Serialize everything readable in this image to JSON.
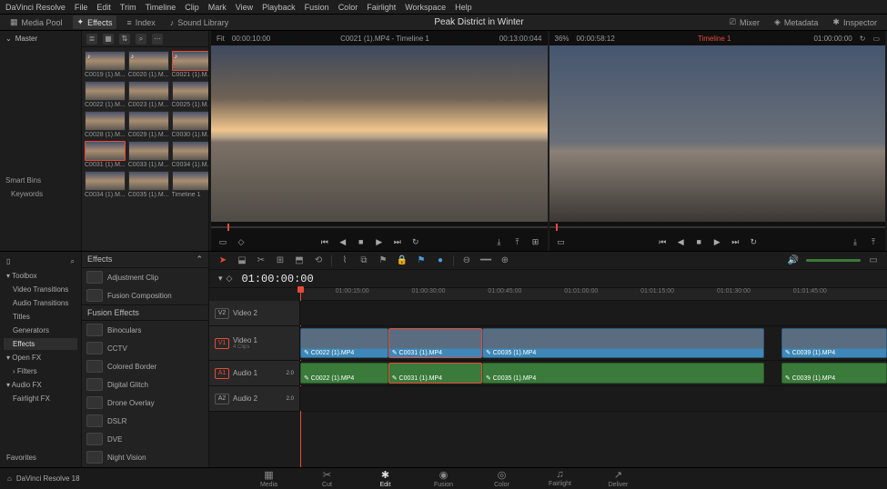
{
  "menubar": [
    "DaVinci Resolve",
    "File",
    "Edit",
    "Trim",
    "Timeline",
    "Clip",
    "Mark",
    "View",
    "Playback",
    "Fusion",
    "Color",
    "Fairlight",
    "Workspace",
    "Help"
  ],
  "topbar": {
    "mediaPool": "Media Pool",
    "effects": "Effects",
    "index": "Index",
    "soundLib": "Sound Library",
    "title": "Peak District in Winter",
    "mixer": "Mixer",
    "metadata": "Metadata",
    "inspector": "Inspector"
  },
  "leftPanel": {
    "master": "Master",
    "smartBins": "Smart Bins",
    "keywords": "Keywords"
  },
  "thumbs": [
    {
      "label": "C0019 (1).M...",
      "audio": true
    },
    {
      "label": "C0020 (1).M...",
      "audio": true
    },
    {
      "label": "C0021 (1).M...",
      "audio": true,
      "sel": true
    },
    {
      "label": "C0022 (1).M..."
    },
    {
      "label": "C0023 (1).M..."
    },
    {
      "label": "C0025 (1).M..."
    },
    {
      "label": "C0028 (1).M..."
    },
    {
      "label": "C0029 (1).M..."
    },
    {
      "label": "C0030 (1).M..."
    },
    {
      "label": "C0031 (1).M...",
      "sel": true
    },
    {
      "label": "C0033 (1).M..."
    },
    {
      "label": "C0034 (1).M..."
    },
    {
      "label": "C0034 (1).M..."
    },
    {
      "label": "C0035 (1).M..."
    },
    {
      "label": "Timeline 1"
    }
  ],
  "sourceViewer": {
    "fit": "Fit",
    "leftTC": "00:00:10:00",
    "clipName": "C0021 (1).MP4 - Timeline 1",
    "rightTC": "00:13:00:044"
  },
  "programViewer": {
    "zoom": "36%",
    "leftTC": "00:00:58:12",
    "timelineName": "Timeline 1",
    "rightTC": "01:00:00:00"
  },
  "fxPanel": {
    "toolbox": "Toolbox",
    "cats": [
      "Video Transitions",
      "Audio Transitions",
      "Titles",
      "Generators",
      "Effects"
    ],
    "catsSel": "Effects",
    "openFX": "Open FX",
    "filters": "Filters",
    "audioFX": "Audio FX",
    "fairlightFX": "Fairlight FX",
    "favorites": "Favorites",
    "effectsHdr": "Effects",
    "adjustmentClip": "Adjustment Clip",
    "fusionComp": "Fusion Composition",
    "fusionEffectsHdr": "Fusion Effects",
    "fxlist": [
      "Binoculars",
      "CCTV",
      "Colored Border",
      "Digital Glitch",
      "Drone Overlay",
      "DSLR",
      "DVE",
      "Night Vision"
    ]
  },
  "timeline": {
    "tc": "01:00:00:00",
    "marks": [
      "01:00:15:00",
      "01:00:30:00",
      "01:00:45:00",
      "01:01:00:00",
      "01:01:15:00",
      "01:01:30:00",
      "01:01:45:00"
    ],
    "tracks": {
      "v2": {
        "tag": "V2",
        "name": "Video 2"
      },
      "v1": {
        "tag": "V1",
        "name": "Video 1",
        "sub": "4 Clips"
      },
      "a1": {
        "tag": "A1",
        "name": "Audio 1",
        "ch": "2.0"
      },
      "a2": {
        "tag": "A2",
        "name": "Audio 2",
        "ch": "2.0"
      }
    },
    "clips": {
      "v1": [
        {
          "label": "C0022 (1).MP4",
          "l": 0,
          "w": 15
        },
        {
          "label": "C0031 (1).MP4",
          "l": 15,
          "w": 16,
          "sel": true
        },
        {
          "label": "C0035 (1).MP4",
          "l": 31,
          "w": 48
        },
        {
          "label": "C0039 (1).MP4",
          "l": 82,
          "w": 18
        }
      ],
      "a1": [
        {
          "label": "C0022 (1).MP4",
          "l": 0,
          "w": 15
        },
        {
          "label": "C0031 (1).MP4",
          "l": 15,
          "w": 16,
          "sel": true
        },
        {
          "label": "C0035 (1).MP4",
          "l": 31,
          "w": 48
        },
        {
          "label": "C0039 (1).MP4",
          "l": 82,
          "w": 18
        }
      ]
    }
  },
  "pages": [
    "Media",
    "Cut",
    "Edit",
    "Fusion",
    "Color",
    "Fairlight",
    "Deliver"
  ],
  "pagesActive": "Edit",
  "brand": "DaVinci Resolve 18"
}
